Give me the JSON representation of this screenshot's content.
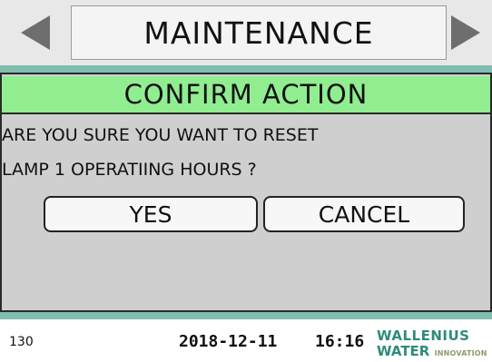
{
  "header": {
    "title": "MAINTENANCE",
    "prev_icon": "triangle-left-icon",
    "next_icon": "triangle-right-icon"
  },
  "dialog": {
    "title": "CONFIRM ACTION",
    "message_line1": "ARE YOU SURE YOU WANT TO RESET",
    "message_line2": "LAMP 1 OPERATIING HOURS ?",
    "yes_label": "YES",
    "cancel_label": "CANCEL"
  },
  "footer": {
    "screen_id": "130",
    "date": "2018-12-11",
    "time": "16:16",
    "logo_line1": "WALLENIUS",
    "logo_line2": "WATER",
    "logo_sub": "INNOVATION"
  },
  "colors": {
    "accent_green": "#90ee90",
    "strip_teal": "#7fbeb0",
    "panel_gray": "#cfcfcf",
    "logo_teal": "#2e8b7a"
  }
}
